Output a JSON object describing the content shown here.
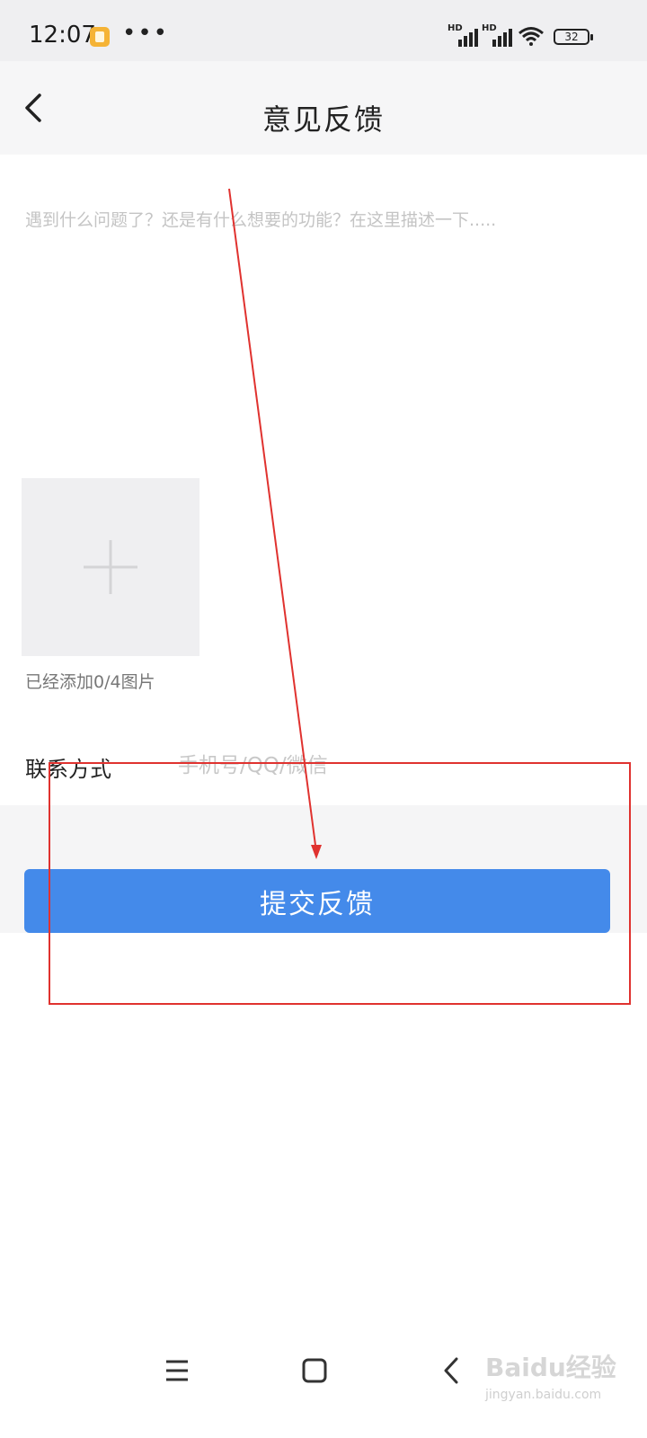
{
  "status_bar": {
    "time": "12:07",
    "signal1_label": "HD",
    "signal2_label": "HD",
    "battery_level": "32",
    "icons": [
      "notification-app-icon",
      "more-dots-icon",
      "signal-icon",
      "wifi-icon",
      "battery-icon"
    ]
  },
  "header": {
    "title": "意见反馈",
    "back_icon": "chevron-left-icon"
  },
  "feedback": {
    "placeholder": "遇到什么问题了？还是有什么想要的功能？在这里描述一下.....",
    "value": ""
  },
  "photos": {
    "add_icon": "plus-icon",
    "count_text": "已经添加0/4图片"
  },
  "contact": {
    "label": "联系方式",
    "placeholder": "手机号/QQ/微信",
    "value": ""
  },
  "submit": {
    "label": "提交反馈",
    "color": "#448aea"
  },
  "annotation": {
    "color": "#e0322f"
  },
  "system_nav": {
    "icons": [
      "menu-icon",
      "home-icon",
      "back-icon"
    ]
  },
  "watermark": {
    "logo": "Baidu经验",
    "url": "jingyan.baidu.com"
  }
}
